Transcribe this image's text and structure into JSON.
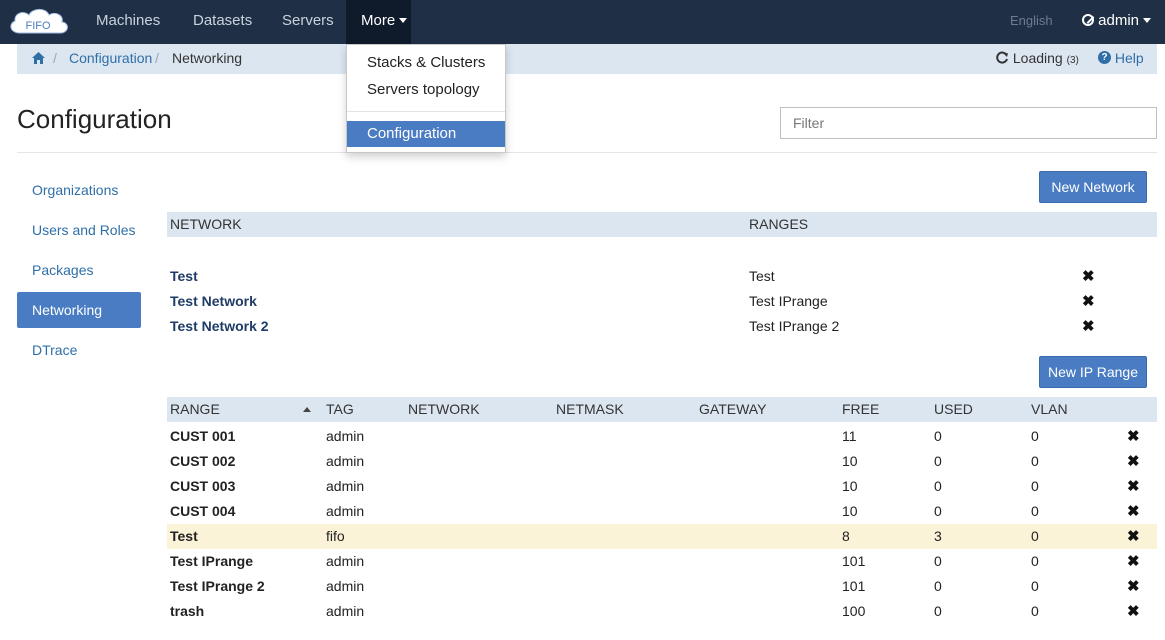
{
  "navbar": {
    "logo_text": "FIFO",
    "items": [
      "Machines",
      "Datasets",
      "Servers"
    ],
    "more_label": "More",
    "language": "English",
    "user": "admin"
  },
  "breadcrumb": {
    "items": [
      "Configuration",
      "Networking"
    ],
    "loading_label": "Loading",
    "loading_count": "(3)",
    "help_label": "Help"
  },
  "dropdown": {
    "items": [
      "Stacks & Clusters",
      "Servers topology"
    ],
    "active_item": "Configuration"
  },
  "page": {
    "title": "Configuration",
    "filter_placeholder": "Filter"
  },
  "sidebar": {
    "items": [
      "Organizations",
      "Users and Roles",
      "Packages",
      "Networking",
      "DTrace"
    ],
    "active": "Networking"
  },
  "networks": {
    "new_button": "New Network",
    "columns": [
      "NETWORK",
      "RANGES"
    ],
    "rows": [
      {
        "network": "Test",
        "ranges": "Test"
      },
      {
        "network": "Test Network",
        "ranges": "Test IPrange"
      },
      {
        "network": "Test Network 2",
        "ranges": "Test IPrange 2"
      }
    ],
    "delete_glyph": "✖"
  },
  "ranges": {
    "new_button": "New IP Range",
    "columns": [
      "RANGE",
      "TAG",
      "NETWORK",
      "NETMASK",
      "GATEWAY",
      "FREE",
      "USED",
      "VLAN"
    ],
    "sorted_column": "RANGE",
    "rows": [
      {
        "range": "CUST 001",
        "tag": "admin",
        "network": "",
        "netmask": "",
        "gateway": "",
        "free": "11",
        "used": "0",
        "vlan": "0"
      },
      {
        "range": "CUST 002",
        "tag": "admin",
        "network": "",
        "netmask": "",
        "gateway": "",
        "free": "10",
        "used": "0",
        "vlan": "0"
      },
      {
        "range": "CUST 003",
        "tag": "admin",
        "network": "",
        "netmask": "",
        "gateway": "",
        "free": "10",
        "used": "0",
        "vlan": "0"
      },
      {
        "range": "CUST 004",
        "tag": "admin",
        "network": "",
        "netmask": "",
        "gateway": "",
        "free": "10",
        "used": "0",
        "vlan": "0"
      },
      {
        "range": "Test",
        "tag": "fifo",
        "network": "",
        "netmask": "",
        "gateway": "",
        "free": "8",
        "used": "3",
        "vlan": "0"
      },
      {
        "range": "Test IPrange",
        "tag": "admin",
        "network": "",
        "netmask": "",
        "gateway": "",
        "free": "101",
        "used": "0",
        "vlan": "0"
      },
      {
        "range": "Test IPrange 2",
        "tag": "admin",
        "network": "",
        "netmask": "",
        "gateway": "",
        "free": "101",
        "used": "0",
        "vlan": "0"
      },
      {
        "range": "trash",
        "tag": "admin",
        "network": "",
        "netmask": "",
        "gateway": "",
        "free": "100",
        "used": "0",
        "vlan": "0"
      }
    ],
    "highlighted_row": "Test",
    "delete_glyph": "✖"
  },
  "colors": {
    "navbar": "#1f2f45",
    "accent": "#4a7cc3",
    "header_band": "#dce6f1",
    "highlight_row": "#fbf3d8"
  }
}
